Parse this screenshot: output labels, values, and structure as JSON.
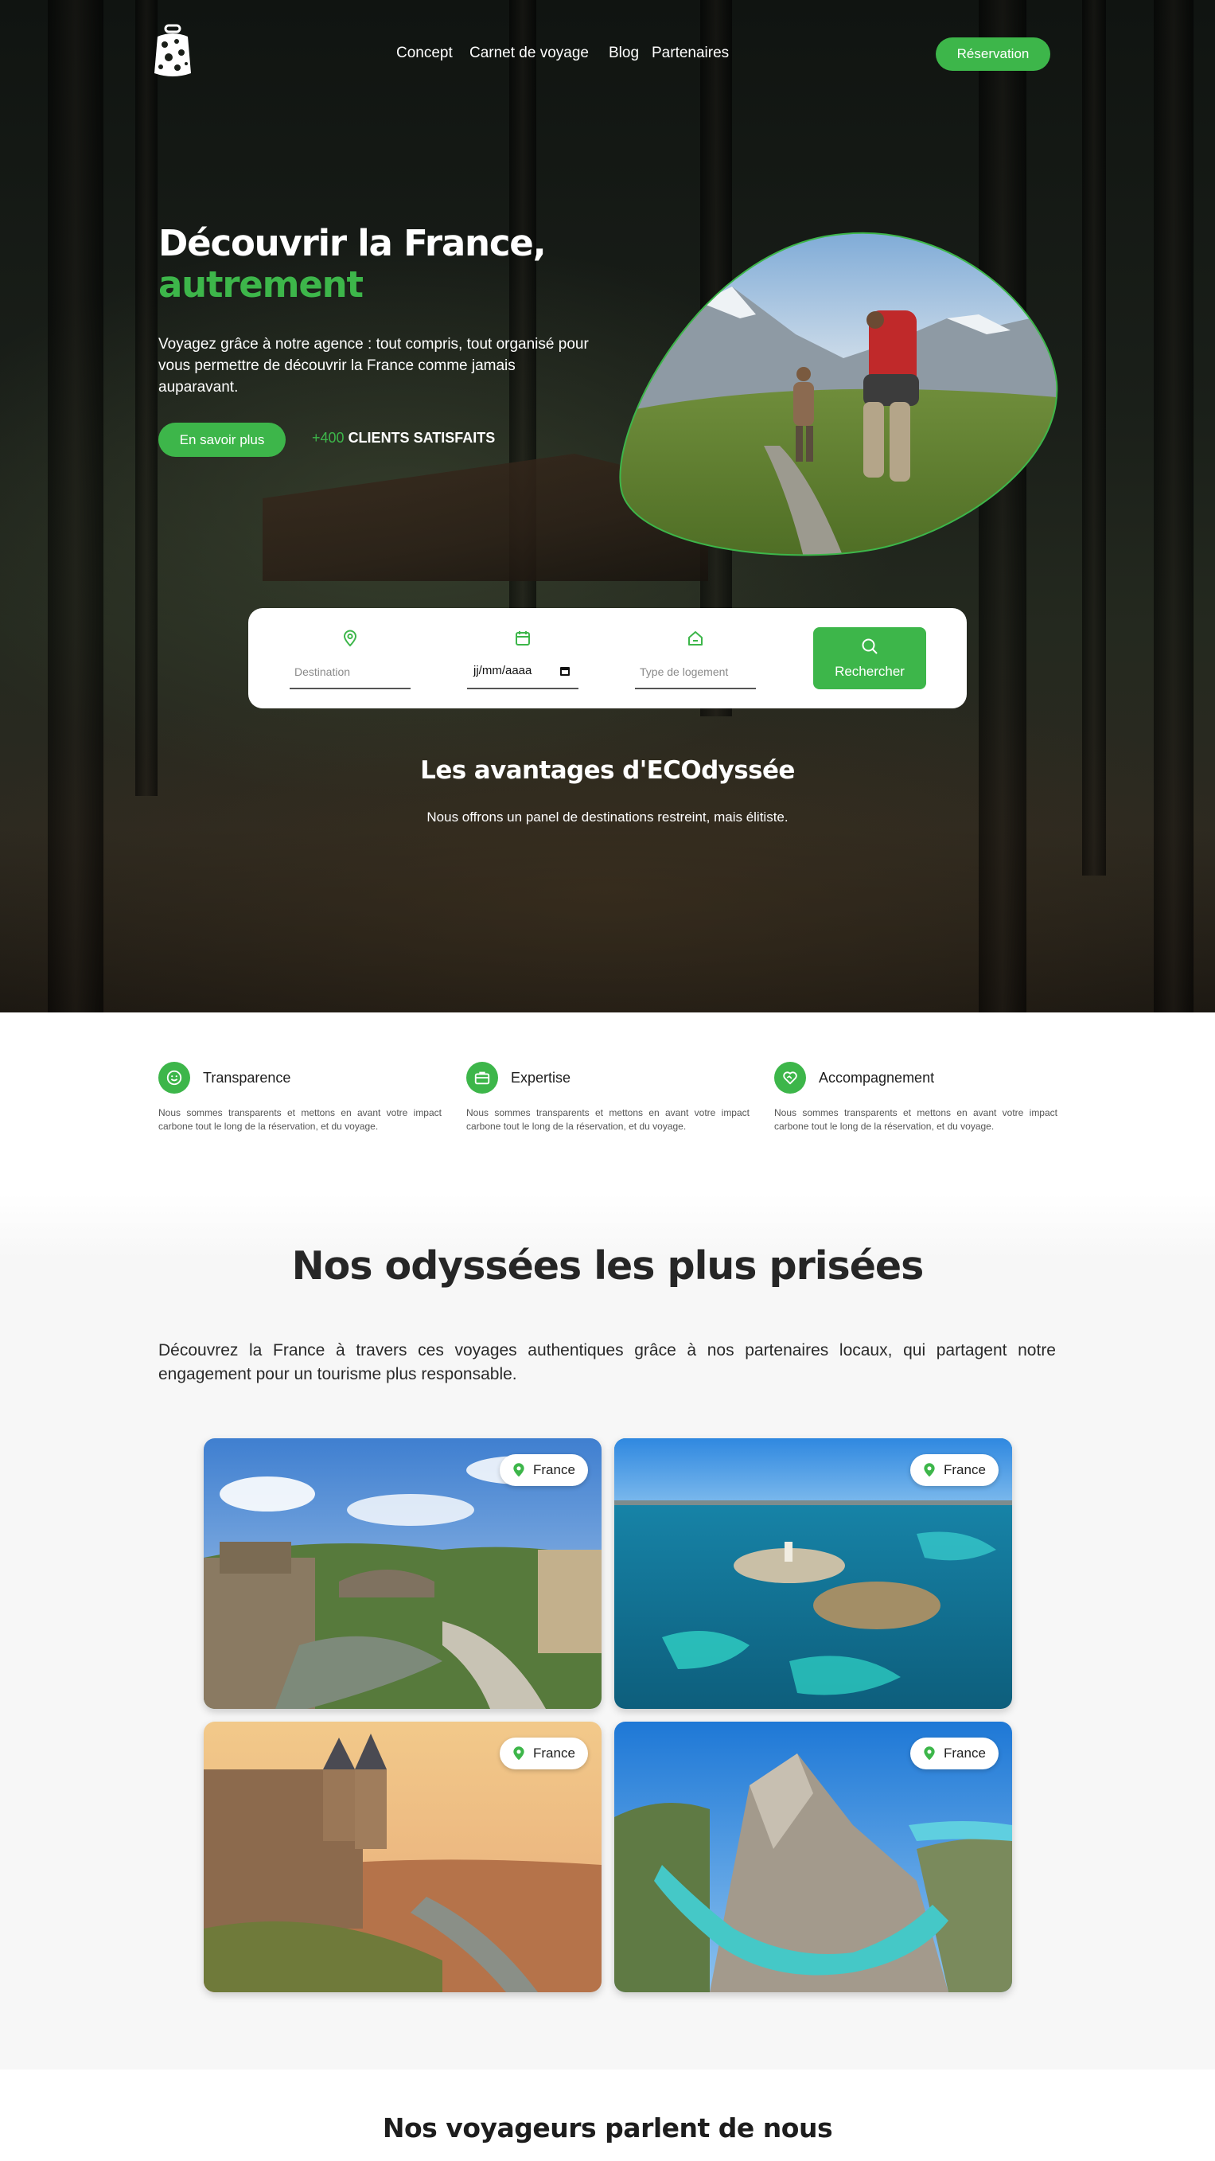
{
  "brand": {
    "accent": "#3db64a",
    "logo": "luggage-leaf-logo"
  },
  "nav": {
    "items": [
      "Concept",
      "Carnet de voyage",
      "Blog",
      "Partenaires"
    ],
    "cta": "Réservation"
  },
  "hero": {
    "title_line1": "Découvrir la France,",
    "title_line2": "autrement",
    "lead": "Voyagez grâce à notre agence : tout compris, tout organisé pour vous permettre de découvrir la France comme jamais auparavant.",
    "cta": "En savoir plus",
    "clients_count": "+400",
    "clients_label": "CLIENTS SATISFAITS"
  },
  "search": {
    "destination_placeholder": "Destination",
    "date_value": "jj/mm/aaaa",
    "lodging_placeholder": "Type de logement",
    "button": "Rechercher"
  },
  "advantages": {
    "title": "Les avantages d'ECOdyssée",
    "subtitle": "Nous offrons un panel de destinations restreint, mais élitiste.",
    "items": [
      {
        "title": "Transparence",
        "text": "Nous sommes transparents et mettons en avant votre impact carbone tout le long de la réservation, et du voyage.",
        "icon": "smile-icon"
      },
      {
        "title": "Expertise",
        "text": "Nous sommes transparents et mettons en avant votre impact carbone tout le long de la réservation, et du voyage.",
        "icon": "briefcase-icon"
      },
      {
        "title": "Accompagnement",
        "text": "Nous sommes transparents et mettons en avant votre impact carbone tout le long de la réservation, et du voyage.",
        "icon": "heart-handshake-icon"
      }
    ]
  },
  "odyssees": {
    "title": "Nos odyssées les plus prisées",
    "text": "Découvrez la France à travers ces voyages authentiques grâce à nos partenaires locaux, qui partagent notre engagement pour un tourisme plus responsable.",
    "cards": [
      {
        "location": "France"
      },
      {
        "location": "France"
      },
      {
        "location": "France"
      },
      {
        "location": "France"
      }
    ]
  },
  "testimonials": {
    "title": "Nos voyageurs parlent de nous"
  }
}
